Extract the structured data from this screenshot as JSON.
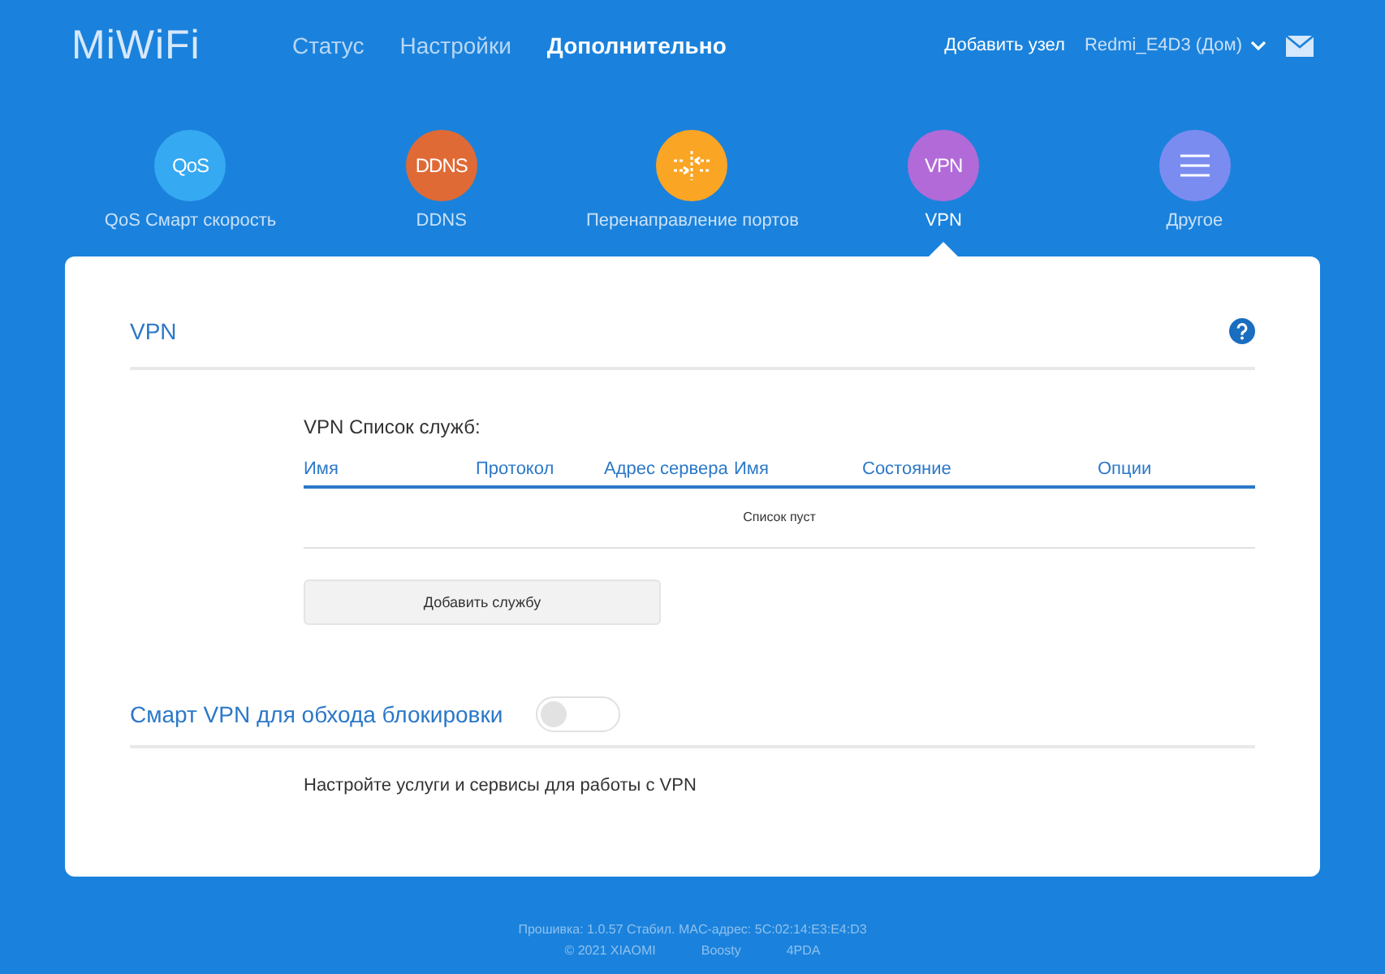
{
  "header": {
    "logo": "MiWiFi",
    "nav": [
      {
        "label": "Статус",
        "selected": false
      },
      {
        "label": "Настройки",
        "selected": false
      },
      {
        "label": "Дополнительно",
        "selected": true
      }
    ],
    "add_node": "Добавить узел",
    "router": "Redmi_E4D3 (Дом)"
  },
  "features": [
    {
      "kind": "text",
      "icon_text": "QoS",
      "label": "QoS Смарт скорость",
      "color": "#35a9f1",
      "selected": false
    },
    {
      "kind": "text",
      "icon_text": "DDNS",
      "label": "DDNS",
      "color": "#e06a35",
      "selected": false
    },
    {
      "kind": "ports",
      "label": "Перенаправление портов",
      "color": "#fba524",
      "selected": false
    },
    {
      "kind": "text",
      "icon_text": "VPN",
      "label": "VPN",
      "color": "#b26ad8",
      "selected": true
    },
    {
      "kind": "menu",
      "label": "Другое",
      "color": "#7b8cf0",
      "selected": false
    }
  ],
  "vpn": {
    "title": "VPN",
    "list_title": "VPN Список служб:",
    "columns": [
      "Имя",
      "Протокол",
      "Адрес сервера",
      "Имя",
      "Состояние",
      "Опции"
    ],
    "empty": "Список пуст",
    "add_button": "Добавить службу"
  },
  "smart_vpn": {
    "title": "Смарт VPN для обхода блокировки",
    "on": false,
    "note": "Настройте услуги и сервисы для работы с VPN"
  },
  "footer": {
    "firmware": "Прошивка: 1.0.57 Стабил. MAC-адрес: 5C:02:14:E3:E4:D3",
    "links": [
      "© 2021 XIAOMI",
      "Boosty",
      "4PDA"
    ]
  }
}
